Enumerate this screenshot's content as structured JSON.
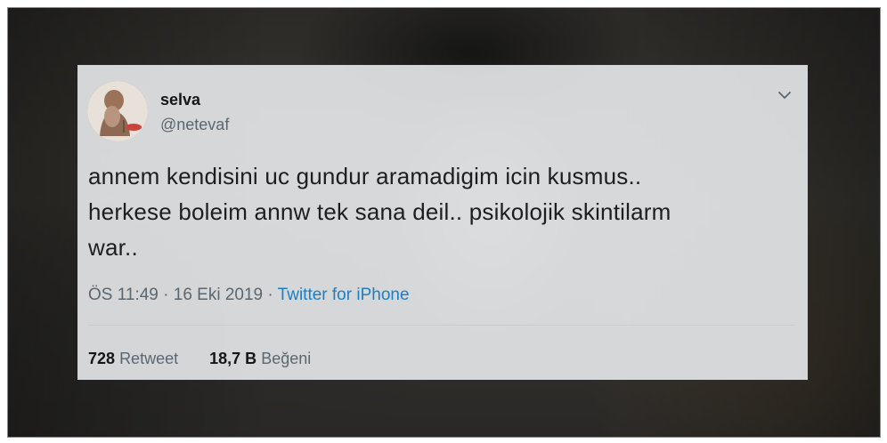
{
  "tweet": {
    "display_name": "selva",
    "handle": "@netevaf",
    "text_lines": [
      "annem kendisini uc gundur aramadigim icin kusmus..",
      "herkese boleim annw tek sana deil.. psikolojik skintilarm",
      "war.."
    ],
    "time": "ÖS 11:49",
    "separator": "·",
    "date": "16 Eki 2019",
    "source": "Twitter for iPhone",
    "retweet_count": "728",
    "retweet_label": "Retweet",
    "like_count": "18,7 B",
    "like_label": "Beğeni"
  },
  "icons": {
    "menu": "chevron-down-icon",
    "avatar": "avatar"
  },
  "colors": {
    "link": "#1b7fc4",
    "muted": "#5b6770",
    "text": "#14171a"
  }
}
